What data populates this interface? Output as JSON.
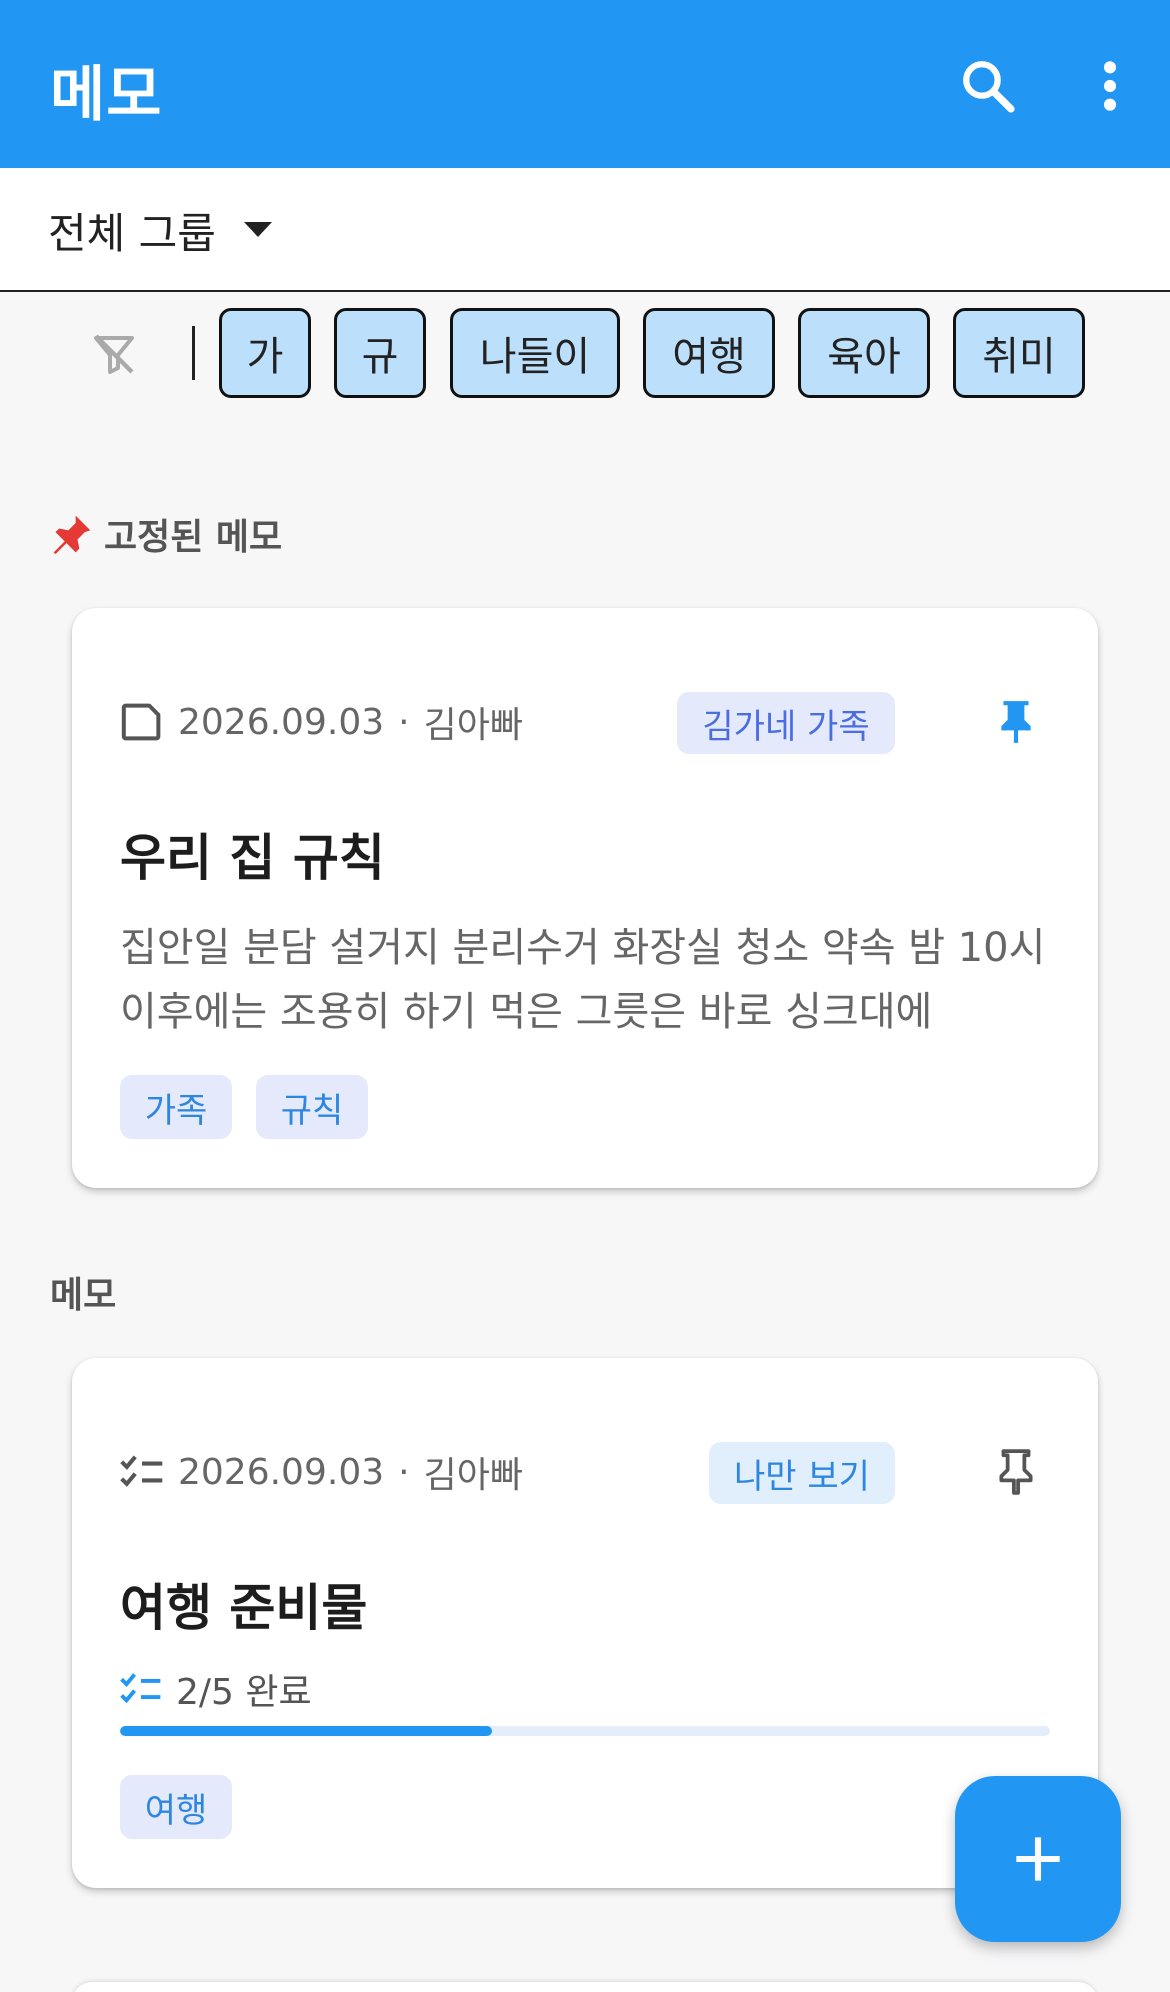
{
  "appbar": {
    "title": "메모",
    "search_icon": "search-icon",
    "more_icon": "more-vertical-icon"
  },
  "group_filter": {
    "selected": "전체 그룹",
    "icon": "dropdown-arrow-icon"
  },
  "tag_filter": {
    "clear_icon": "filter-off-icon",
    "chips": [
      "가",
      "규",
      "나들이",
      "여행",
      "육아",
      "취미"
    ]
  },
  "sections": {
    "pinned_label": "고정된 메모",
    "pinned_icon": "pushpin-icon",
    "notes_label": "메모"
  },
  "pinned_memo": {
    "type_icon": "note-icon",
    "date": "2026.09.03",
    "separator": "·",
    "author": "김아빠",
    "group": "김가네 가족",
    "pinned": true,
    "title": "우리 집 규칙",
    "body": "집안일 분담 설거지 분리수거 화장실 청소 약속 밤 10시 이후에는 조용히 하기 먹은 그릇은 바로 싱크대에",
    "tags": [
      "가족",
      "규칙"
    ]
  },
  "memo": {
    "type_icon": "checklist-icon",
    "date": "2026.09.03",
    "separator": "·",
    "author": "김아빠",
    "group": "나만 보기",
    "pinned": false,
    "title": "여행 준비물",
    "progress_text": "2/5 완료",
    "progress": 0.4,
    "tags": [
      "여행"
    ]
  },
  "fab": {
    "icon": "add-icon"
  },
  "colors": {
    "primary": "#2196f3",
    "chip_bg": "#bcdffb",
    "tag_bg": "#e4e9fb"
  }
}
